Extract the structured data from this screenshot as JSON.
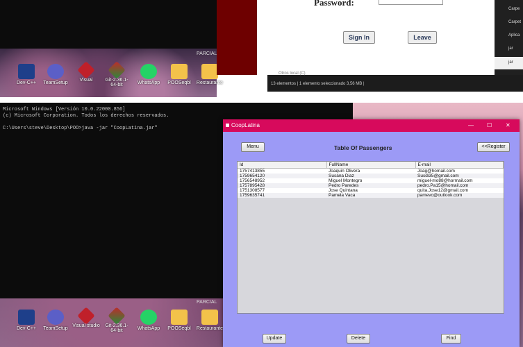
{
  "top": {
    "login_window": {
      "password_label": "Password:",
      "sign_in_label": "Sign In",
      "leave_label": "Leave"
    },
    "explorer": {
      "side_items": [
        "Carpe",
        "Carpet",
        "Aplica",
        "jar",
        "jar"
      ],
      "status_text": "13 elementos  |  1 elemento seleccionado  3,56 MB  |",
      "faded_text": "Otros local (C)"
    },
    "desktop_icons": [
      "Dev-C++",
      "TeamSetup",
      "Visual",
      "Git-2.36.1-64-bit",
      "WhatsApp",
      "POOSeqbl",
      "Restaurante"
    ],
    "watermark": "PARCIAL"
  },
  "terminal": {
    "lines": [
      "Microsoft Windows [Versión 10.0.22000.856]",
      "(c) Microsoft Corporation. Todos los derechos reservados.",
      "",
      "C:\\Users\\steve\\Desktop\\POO>java -jar \"CoopLatina.jar\""
    ]
  },
  "bottom_desktop_icons": [
    "Dev-C++",
    "TeamSetup",
    "Visual studio",
    "Git-2.36.1-64-bit",
    "WhatsApp",
    "POOSeqbl",
    "Restaurante"
  ],
  "bottom_watermark": "PARCIAL",
  "app": {
    "title": "CoopLatina",
    "window_controls": {
      "minimize": "—",
      "maximize": "☐",
      "close": "✕"
    },
    "menu_label": "Menu",
    "heading": "Table Of Passengers",
    "register_label": "<<Register",
    "columns": [
      "Id",
      "FullName",
      "E-mail"
    ],
    "rows": [
      [
        "1757413855",
        "Joaquin Olivera",
        "Joag@homail.com"
      ],
      [
        "1759654120",
        "Susana Diaz",
        "Susdi35@gmail.com"
      ],
      [
        "1756548952",
        "Miguel Montegro",
        "miguel-mo88@hormail.com"
      ],
      [
        "1757895428",
        "Pedro Paredes",
        "pedro.Pa15@homail.com"
      ],
      [
        "1751308577",
        "Jose Quintana",
        "quita.Jose12@gmail.com"
      ],
      [
        "1759635741",
        "Pamela Vaca",
        "pamevc@outlook.com"
      ]
    ],
    "update_label": "Update",
    "delete_label": "Delete",
    "find_label": "Find"
  }
}
